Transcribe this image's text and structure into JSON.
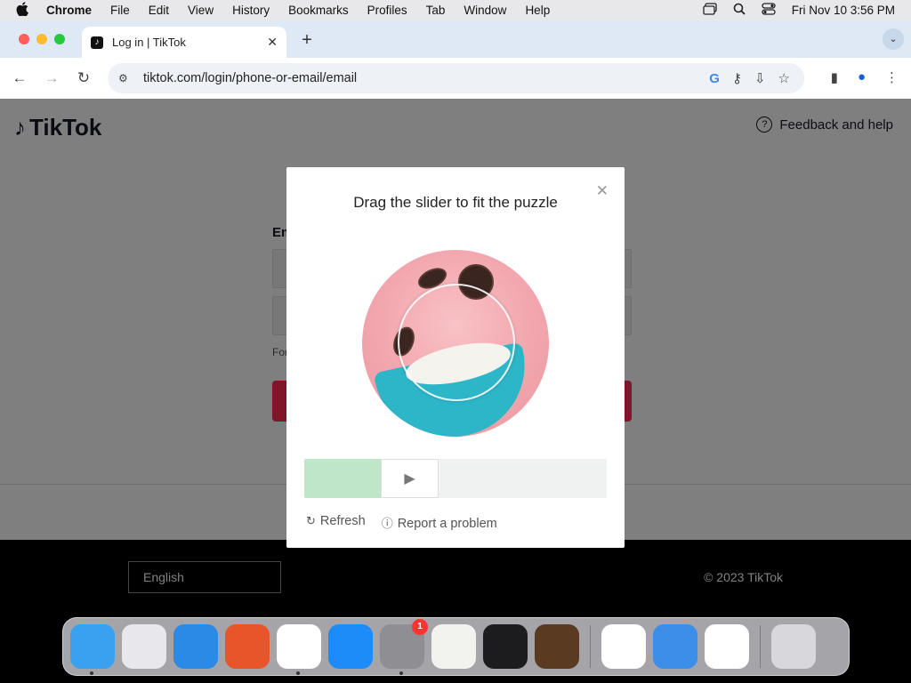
{
  "menubar": {
    "app": "Chrome",
    "items": [
      "File",
      "Edit",
      "View",
      "History",
      "Bookmarks",
      "Profiles",
      "Tab",
      "Window",
      "Help"
    ],
    "datetime": "Fri Nov 10  3:56 PM"
  },
  "browser": {
    "tab_title": "Log in | TikTok",
    "url": "tiktok.com/login/phone-or-email/email"
  },
  "page": {
    "logo_text": "TikTok",
    "feedback_label": "Feedback and help",
    "login_label": "Em",
    "login_hint": "e",
    "forgot_text": "For",
    "language": "English",
    "copyright": "© 2023 TikTok"
  },
  "captcha": {
    "title": "Drag the slider to fit the puzzle",
    "slider_progress": 0.25,
    "refresh_label": "Refresh",
    "report_label": "Report a problem"
  },
  "dock": {
    "apps": [
      {
        "name": "Finder",
        "icon": "finder-icon",
        "color": "#3aa0f0",
        "running": true
      },
      {
        "name": "Launchpad",
        "icon": "launchpad-icon",
        "color": "#e8e8ec",
        "running": false
      },
      {
        "name": "Safari",
        "icon": "safari-icon",
        "color": "#2a8ae6",
        "running": false
      },
      {
        "name": "Firefox",
        "icon": "firefox-icon",
        "color": "#e8552a",
        "running": false
      },
      {
        "name": "Chrome",
        "icon": "chrome-icon",
        "color": "#ffffff",
        "running": true
      },
      {
        "name": "App Store",
        "icon": "app-store-icon",
        "color": "#1d8cf8",
        "running": false
      },
      {
        "name": "System Settings",
        "icon": "system-settings-icon",
        "color": "#8e8e93",
        "running": true,
        "badge": "1"
      },
      {
        "name": "TextEdit",
        "icon": "textedit-icon",
        "color": "#f2f2ee",
        "running": false
      },
      {
        "name": "Terminal",
        "icon": "terminal-icon",
        "color": "#1c1c1e",
        "running": false
      },
      {
        "name": "GarageBand",
        "icon": "garageband-icon",
        "color": "#5a3a20",
        "running": false
      },
      {
        "name": "VS Code",
        "icon": "vscode-icon",
        "color": "#ffffff",
        "running": false
      },
      {
        "name": "Weather",
        "icon": "weather-icon",
        "color": "#3c8ee8",
        "running": false
      },
      {
        "name": "Screen Sharing",
        "icon": "screen-sharing-icon",
        "color": "#ffffff",
        "running": false
      },
      {
        "name": "Trash",
        "icon": "trash-icon",
        "color": "#d8d8dc",
        "running": false
      }
    ]
  }
}
